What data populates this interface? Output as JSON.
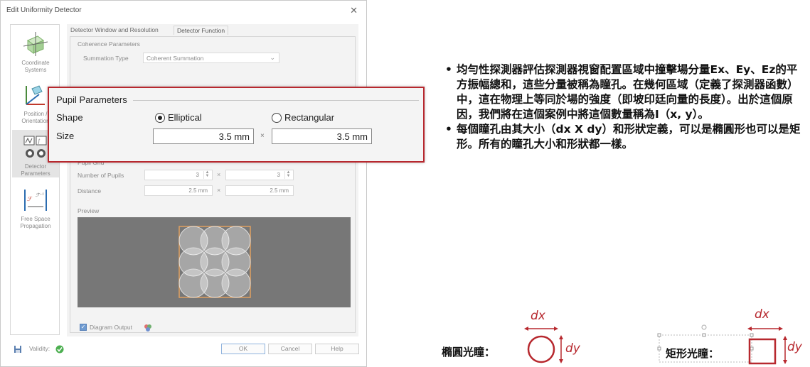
{
  "dialog": {
    "title": "Edit Uniformity Detector",
    "close_glyph": "✕",
    "nav": [
      {
        "label": "Coordinate Systems",
        "icon": "coordinate-systems-icon"
      },
      {
        "label": "Position / Orientation",
        "icon": "position-orientation-icon"
      },
      {
        "label": "Detector Parameters",
        "icon": "detector-parameters-icon"
      },
      {
        "label": "Free Space Propagation",
        "icon": "free-space-propagation-icon"
      }
    ],
    "tabs": [
      "Detector Window and Resolution",
      "Detector Function"
    ],
    "coherence": {
      "title": "Coherence Parameters",
      "summation_label": "Summation Type",
      "summation_value": "Coherent Summation"
    },
    "pupil_grid": {
      "title": "Pupil Grid",
      "number_label": "Number of Pupils",
      "number_x": "3",
      "number_y": "3",
      "distance_label": "Distance",
      "distance_x": "2.5 mm",
      "distance_y": "2.5 mm",
      "preview_label": "Preview"
    },
    "diagram_output_label": "Diagram Output",
    "validity_label": "Validity:",
    "buttons": {
      "ok": "OK",
      "cancel": "Cancel",
      "help": "Help"
    },
    "times_glyph": "×"
  },
  "pupil_parameters": {
    "title": "Pupil Parameters",
    "shape_label": "Shape",
    "option_elliptical": "Elliptical",
    "option_rectangular": "Rectangular",
    "selected": "Elliptical",
    "size_label": "Size",
    "size_x": "3.5 mm",
    "size_y": "3.5 mm",
    "times_glyph": "×"
  },
  "notes": [
    "均勻性探測器評估探測器視窗配置區域中撞擊場分量Ex、Ey、Ez的平方振幅總和，這些分量被稱為瞳孔。在幾何區域（定義了探測器函數）中，這在物理上等同於場的強度（即坡印廷向量的長度）。出於這個原因，我們將在這個案例中將這個數量稱為I（x, y）。",
    "每個瞳孔由其大小（dx X dy）和形狀定義，可以是橢圓形也可以是矩形。所有的瞳孔大小和形狀都一樣。"
  ],
  "shapes": {
    "elliptical_caption": "橢圓光瞳：",
    "rectangular_caption": "矩形光瞳：",
    "dx": "dx",
    "dy": "dy"
  },
  "colors": {
    "accent_red": "#b7282e",
    "preview_bg": "#777777",
    "pupil_outline": "#e0a060",
    "checkbox_blue": "#6f9bd1",
    "valid_green": "#4caf50"
  }
}
